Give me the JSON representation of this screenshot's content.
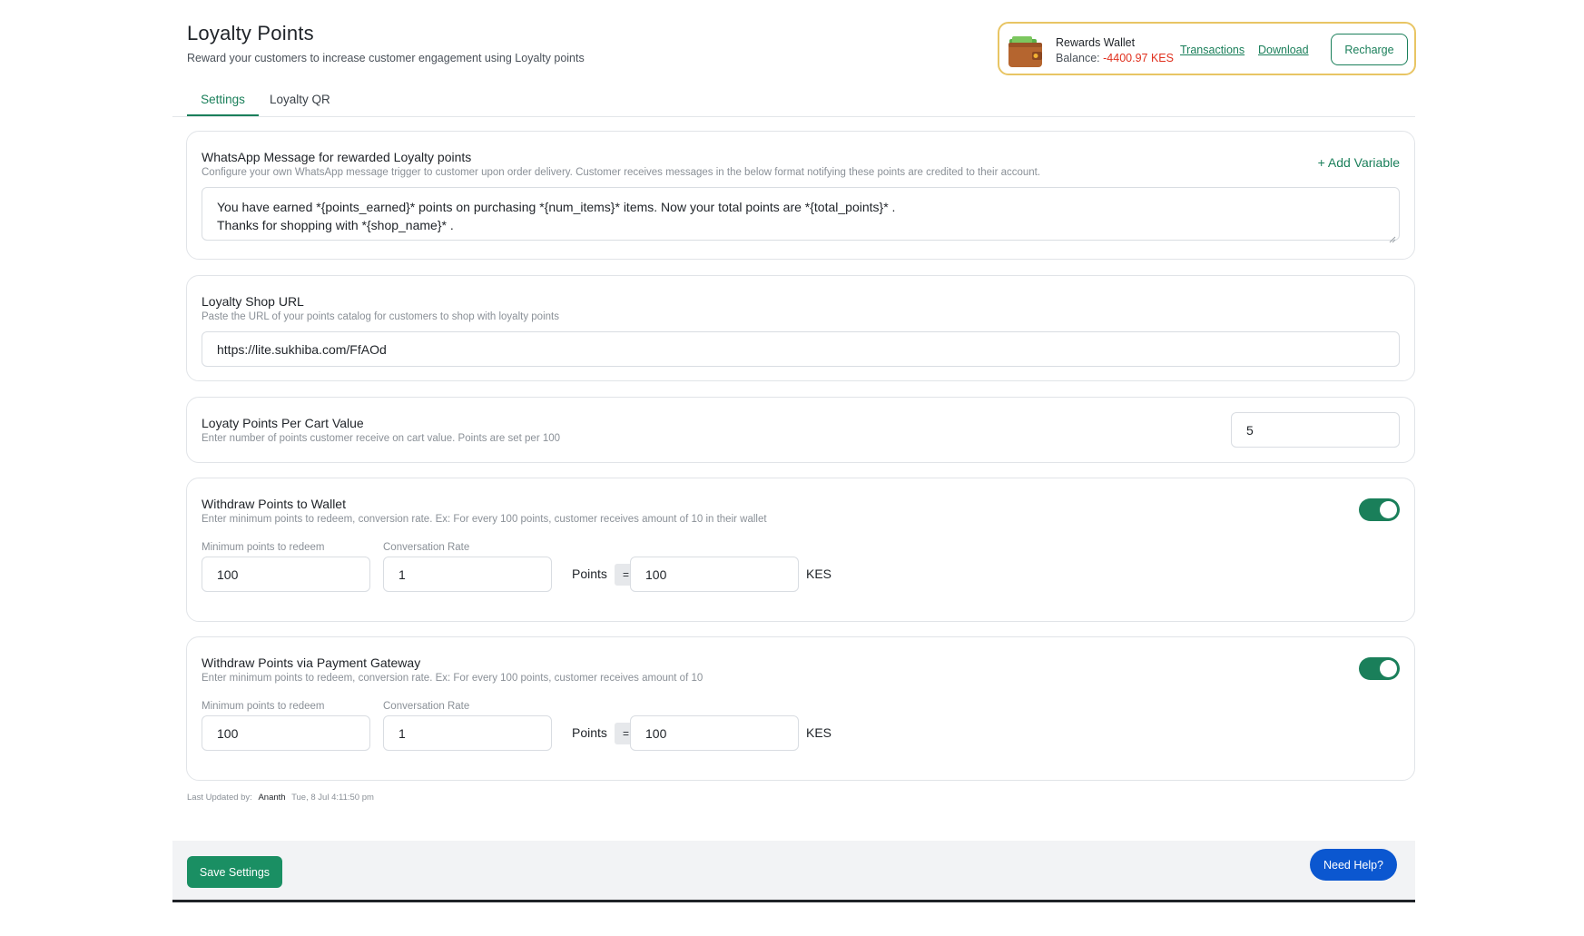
{
  "header": {
    "title": "Loyalty Points",
    "subtitle": "Reward your customers to increase customer engagement using Loyalty points"
  },
  "wallet": {
    "title": "Rewards Wallet",
    "balance_label": "Balance:",
    "balance_value": "-4400.97 KES",
    "transactions_label": "Transactions",
    "download_label": "Download",
    "recharge_label": "Recharge",
    "icon": "wallet-icon"
  },
  "tabs": [
    {
      "label": "Settings",
      "active": true
    },
    {
      "label": "Loyalty QR",
      "active": false
    }
  ],
  "whatsapp": {
    "title": "WhatsApp Message for rewarded Loyalty points",
    "description": "Configure your own WhatsApp message trigger to customer upon order delivery. Customer receives messages in the below format notifying these points are credited to their account.",
    "add_variable_label": "+ Add Variable",
    "message_line1": "You have earned *{points_earned}* points on purchasing *{num_items}* items. Now your total points are *{total_points}* .",
    "message_line2": "Thanks for shopping with *{shop_name}* ."
  },
  "shop_url": {
    "title": "Loyalty Shop URL",
    "description": "Paste the URL of your points catalog for customers to shop with loyalty points",
    "value": "https://lite.sukhiba.com/FfAOd"
  },
  "cart_value": {
    "title": "Loyaty Points Per Cart Value",
    "description": "Enter number of points customer receive on cart value. Points are set per 100",
    "value": "5"
  },
  "withdraw_wallet": {
    "title": "Withdraw Points to Wallet",
    "description": "Enter minimum points to redeem, conversion rate. Ex: For every 100 points, customer receives amount of 10 in their wallet",
    "enabled": true,
    "min_label": "Minimum points to redeem",
    "rate_label": "Conversation Rate",
    "min_value": "100",
    "rate_value": "1",
    "points_label": "Points",
    "equals": "=",
    "amount_value": "100",
    "currency": "KES"
  },
  "withdraw_gateway": {
    "title": "Withdraw Points via Payment Gateway",
    "description": "Enter minimum points to redeem, conversion rate. Ex: For every 100 points, customer receives amount of 10",
    "enabled": true,
    "min_label": "Minimum points to redeem",
    "rate_label": "Conversation Rate",
    "min_value": "100",
    "rate_value": "1",
    "points_label": "Points",
    "equals": "=",
    "amount_value": "100",
    "currency": "KES"
  },
  "last_updated": {
    "label": "Last Updated by:",
    "user": "Ananth",
    "timestamp": "Tue, 8 Jul 4:11:50 pm"
  },
  "footer": {
    "save_label": "Save Settings",
    "help_label": "Need Help?"
  },
  "colors": {
    "accent": "#1a7f5a",
    "negative": "#e0301e",
    "help_button": "#0b57d0",
    "wallet_border": "#e8c564"
  }
}
